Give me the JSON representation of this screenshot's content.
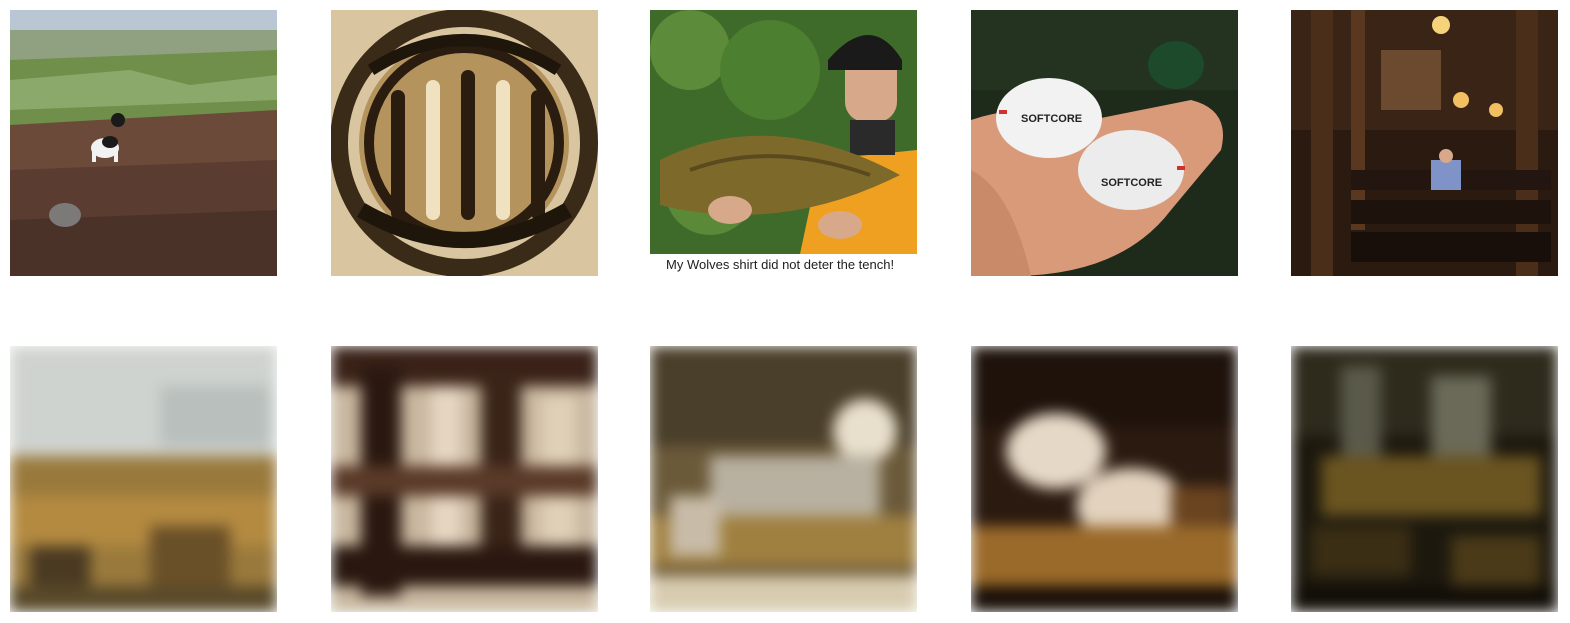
{
  "figure": {
    "rows": [
      {
        "row": "original",
        "tiles": [
          {
            "subject": "dog-on-moorland",
            "caption": ""
          },
          {
            "subject": "french-horn",
            "caption": ""
          },
          {
            "subject": "man-holding-tench",
            "caption": "My Wolves shirt did not deter the tench!"
          },
          {
            "subject": "golf-balls-in-hand",
            "caption": "",
            "ball_text": "SOFTCORE"
          },
          {
            "subject": "church-interior",
            "caption": ""
          }
        ]
      },
      {
        "row": "reconstruction",
        "tiles": [
          {
            "subject": "blurred-reconstruction-1"
          },
          {
            "subject": "blurred-reconstruction-2"
          },
          {
            "subject": "blurred-reconstruction-3"
          },
          {
            "subject": "blurred-reconstruction-4"
          },
          {
            "subject": "blurred-reconstruction-5"
          }
        ]
      }
    ],
    "colors": {
      "background": "#ffffff",
      "heather": "#6b4a3a",
      "brass": "#a07a3c",
      "foliage": "#3f6b2a",
      "shirt_orange": "#f0a020",
      "dark_green": "#1e2a1a",
      "church_wood": "#3a2416"
    }
  }
}
